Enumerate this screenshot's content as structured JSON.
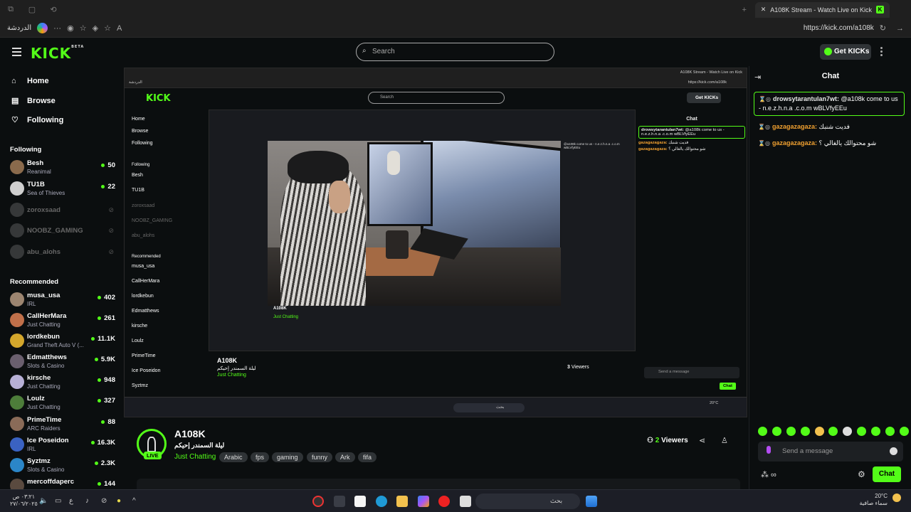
{
  "browser": {
    "tab_title": "A108K Stream - Watch Live on Kick",
    "profile_label": "الدردشة",
    "url": "https://kick.com/a108k"
  },
  "header": {
    "logo": "KICK",
    "logo_badge": "BETA",
    "search_placeholder": "Search",
    "get_kicks": "Get KICKs"
  },
  "nav": {
    "home": "Home",
    "browse": "Browse",
    "following": "Following"
  },
  "following": {
    "title": "Following",
    "channels": [
      {
        "name": "Besh",
        "category": "Reanimal",
        "viewers": "50"
      },
      {
        "name": "TU1B",
        "category": "Sea of Thieves",
        "viewers": "22"
      }
    ],
    "offline": [
      "zoroxsaad",
      "NOOBZ_GAMING",
      "abu_alohs"
    ]
  },
  "recommended": {
    "title": "Recommended",
    "channels": [
      {
        "name": "musa_usa",
        "category": "IRL",
        "viewers": "402"
      },
      {
        "name": "CallHerMara",
        "category": "Just Chatting",
        "viewers": "261"
      },
      {
        "name": "lordkebun",
        "category": "Grand Theft Auto V (...",
        "viewers": "11.1K"
      },
      {
        "name": "Edmatthews",
        "category": "Slots & Casino",
        "viewers": "5.9K"
      },
      {
        "name": "kirsche",
        "category": "Just Chatting",
        "viewers": "948"
      },
      {
        "name": "Loulz",
        "category": "Just Chatting",
        "viewers": "327"
      },
      {
        "name": "PrimeTime",
        "category": "ARC Raiders",
        "viewers": "88"
      },
      {
        "name": "Ice Poseidon",
        "category": "IRL",
        "viewers": "16.3K"
      },
      {
        "name": "Syztmz",
        "category": "Slots & Casino",
        "viewers": "2.3K"
      },
      {
        "name": "mercoffdaperc",
        "category": "",
        "viewers": "144"
      }
    ]
  },
  "stream": {
    "live_label": "LIVE",
    "username": "A108K",
    "title": "ليلة السمندر إحيكم",
    "category": "Just Chatting",
    "tags": [
      "Arabic",
      "fps",
      "gaming",
      "funny",
      "Ark",
      "fifa"
    ],
    "viewers_count": "2",
    "viewers_label": "Viewers"
  },
  "nested": {
    "viewers_count": "3",
    "viewers_label": "Viewers",
    "send_placeholder": "Send a message",
    "chat_button": "Chat"
  },
  "chat": {
    "title": "Chat",
    "messages": [
      {
        "user": "drowsytarantulan7wt:",
        "text": "@a108k come to us - n.e.z.h.n.a .c.o.m wBLVfyEEu",
        "user_color": "#e8e8e8",
        "highlight": true
      },
      {
        "user": "gazagazagaza:",
        "text": "فديت شنبك",
        "user_color": "#f0a030",
        "highlight": false
      },
      {
        "user": "gazagazagaza:",
        "text": "شو محتوالك يالغالي ؟",
        "user_color": "#f0a030",
        "highlight": false
      }
    ],
    "input_placeholder": "Send a message",
    "send_button": "Chat"
  },
  "taskbar": {
    "time": "٠٣:٢١ ص",
    "date": "٢٧/٠٦/٢٠٢٥",
    "search_text": "بحث",
    "language": "ع",
    "temperature": "20°C",
    "weather_text": "سماء صافية"
  }
}
